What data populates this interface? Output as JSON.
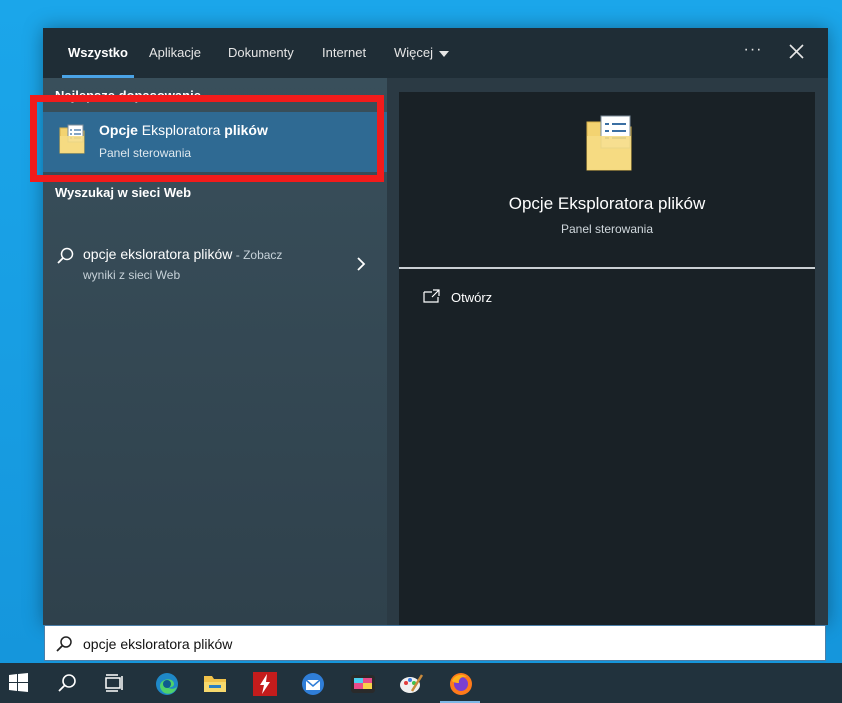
{
  "tabs": [
    {
      "label": "Wszystko",
      "active": true
    },
    {
      "label": "Aplikacje"
    },
    {
      "label": "Dokumenty"
    },
    {
      "label": "Internet"
    },
    {
      "label": "Więcej"
    }
  ],
  "header": {
    "more_label": "···"
  },
  "best_match": {
    "section_label": "Najlepsze dopasowanie",
    "title_part1": "Opcje",
    "title_part2": " Eksploratora ",
    "title_part3": "plików",
    "subtitle": "Panel sterowania"
  },
  "web": {
    "section_label": "Wyszukaj w sieci Web",
    "query": "opcje eksloratora plików",
    "suffix_line1": " - Zobacz",
    "suffix_line2": "wyniki z sieci Web"
  },
  "detail": {
    "title": "Opcje Eksploratora plików",
    "subtitle": "Panel sterowania",
    "open_label": "Otwórz"
  },
  "search": {
    "value": "opcje eksloratora plików"
  },
  "taskbar": {
    "items": [
      "start-icon",
      "search-icon",
      "task-view-icon",
      "edge-icon",
      "file-explorer-icon",
      "red-app-icon",
      "mail-icon",
      "media-app-icon",
      "paint-icon",
      "firefox-icon"
    ]
  },
  "colors": {
    "highlight_border": "#f21b1b",
    "selected_item": "#2f6a93",
    "accent": "#4aa3e6"
  }
}
